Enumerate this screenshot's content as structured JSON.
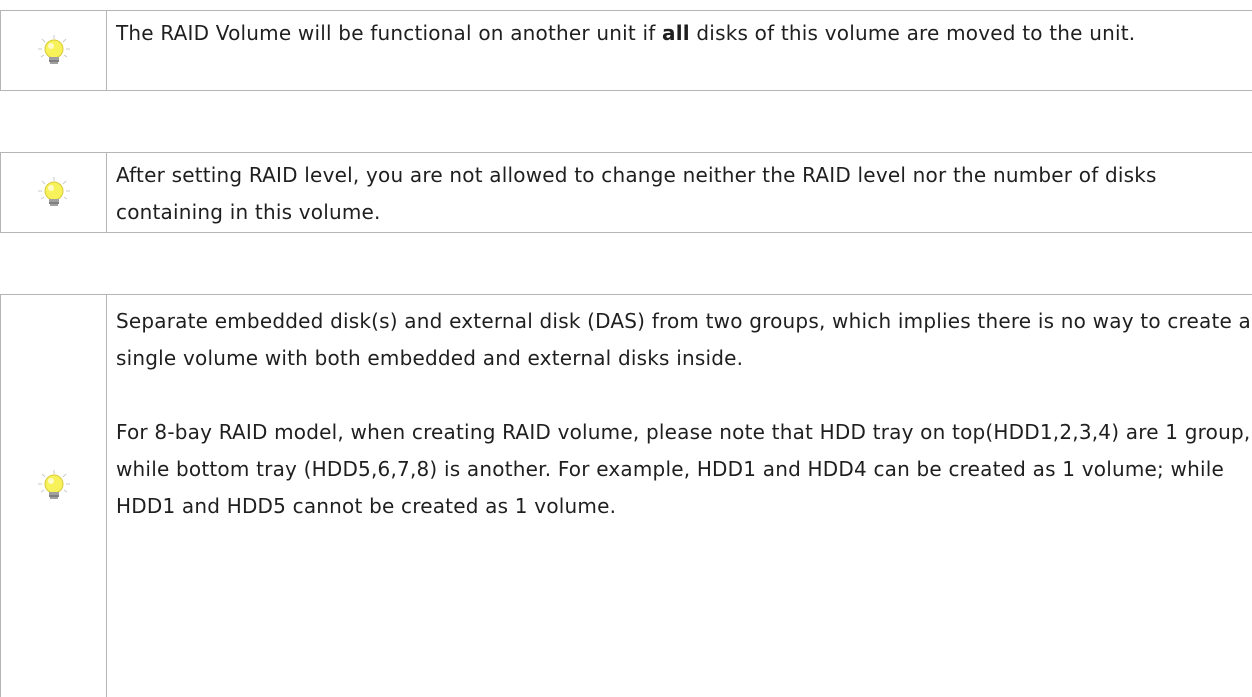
{
  "notes": [
    {
      "icon": "lightbulb-icon",
      "text_before": "The RAID Volume will be functional on another unit if ",
      "text_bold": "all",
      "text_after": " disks of this volume are moved to the unit."
    },
    {
      "icon": "lightbulb-icon",
      "text": "After setting RAID level, you are not allowed to change neither the RAID level nor the number of disks containing in this volume."
    },
    {
      "icon": "lightbulb-icon",
      "paragraph1": "Separate embedded disk(s) and external disk (DAS) from two groups, which implies there is no way to create a single volume with both embedded and external disks inside.",
      "paragraph2": "For 8-bay RAID model, when creating RAID volume, please note that HDD tray on top(HDD1,2,3,4) are 1 group, while bottom tray (HDD5,6,7,8) is another. For example, HDD1 and HDD4 can be created as 1 volume; while HDD1 and HDD5 cannot be created as 1 volume."
    }
  ],
  "colors": {
    "border": "#b5b5b5",
    "bulb_glass": "#f7f25a",
    "bulb_base": "#8c8c8c"
  }
}
